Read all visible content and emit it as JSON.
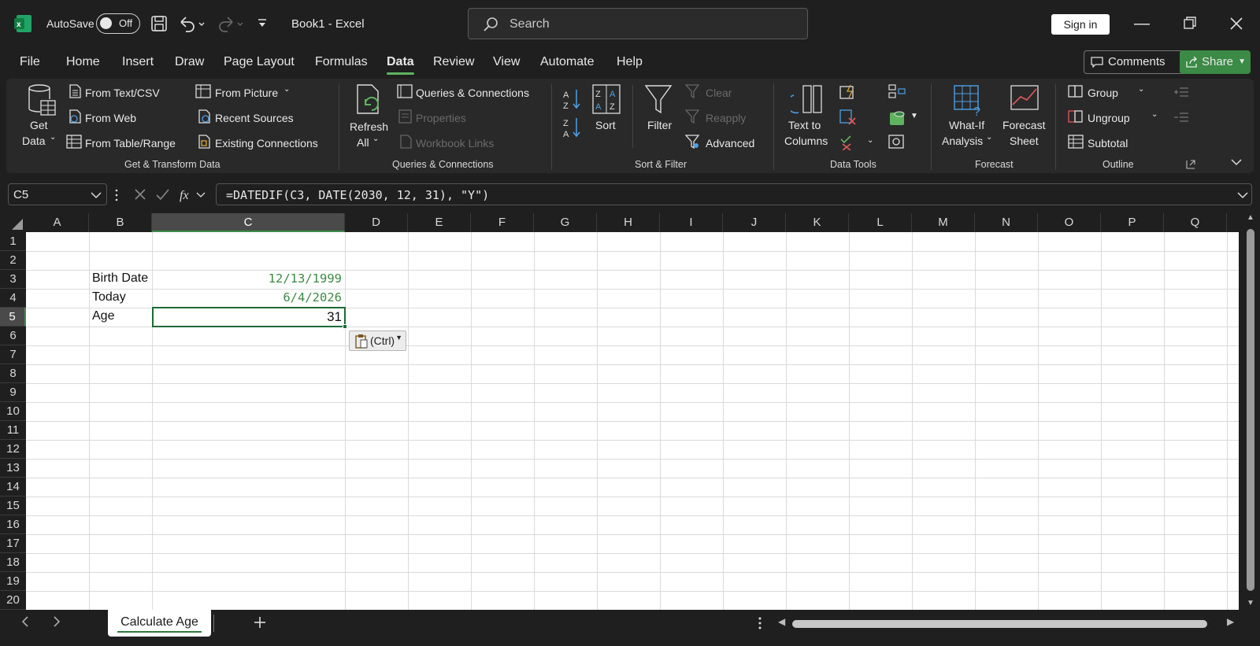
{
  "app": {
    "autosave_label": "AutoSave",
    "autosave_state": "Off",
    "title": "Book1  -  Excel",
    "search_placeholder": "Search",
    "signin_label": "Sign in"
  },
  "menu": {
    "tabs": [
      "File",
      "Home",
      "Insert",
      "Draw",
      "Page Layout",
      "Formulas",
      "Data",
      "Review",
      "View",
      "Automate",
      "Help"
    ],
    "active_tab": "Data",
    "comments_label": "Comments",
    "share_label": "Share"
  },
  "ribbon": {
    "get_data": [
      "Get",
      "Data"
    ],
    "from_text_csv": "From Text/CSV",
    "from_web": "From Web",
    "from_table_range": "From Table/Range",
    "from_picture": "From Picture",
    "recent_sources": "Recent Sources",
    "existing_connections": "Existing Connections",
    "group_get_transform": "Get & Transform Data",
    "refresh_all": [
      "Refresh",
      "All"
    ],
    "queries_connections": "Queries & Connections",
    "properties": "Properties",
    "workbook_links": "Workbook Links",
    "group_queries": "Queries & Connections",
    "sort": "Sort",
    "filter": "Filter",
    "clear": "Clear",
    "reapply": "Reapply",
    "advanced": "Advanced",
    "group_sort_filter": "Sort & Filter",
    "text_to_columns": [
      "Text to",
      "Columns"
    ],
    "group_data_tools": "Data Tools",
    "what_if": [
      "What-If",
      "Analysis"
    ],
    "forecast_sheet": [
      "Forecast",
      "Sheet"
    ],
    "group_forecast": "Forecast",
    "group": "Group",
    "ungroup": "Ungroup",
    "subtotal": "Subtotal",
    "group_outline": "Outline"
  },
  "formula_bar": {
    "name_box": "C5",
    "formula": "=DATEDIF(C3, DATE(2030, 12, 31), \"Y\")"
  },
  "grid": {
    "columns": [
      "A",
      "B",
      "C",
      "D",
      "E",
      "F",
      "G",
      "H",
      "I",
      "J",
      "K",
      "L",
      "M",
      "N",
      "O",
      "P",
      "Q"
    ],
    "rows": [
      "1",
      "2",
      "3",
      "4",
      "5",
      "6",
      "7",
      "8",
      "9",
      "10",
      "11",
      "12",
      "13",
      "14",
      "15",
      "16",
      "17",
      "18",
      "19",
      "20"
    ],
    "selected_column": "C",
    "selected_row": "5",
    "cells": {
      "B3": "Birth Date",
      "C3": "12/13/1999",
      "B4": "Today",
      "C4": "6/4/2026",
      "B5": "Age",
      "C5": "31"
    },
    "paste_options_label": "(Ctrl)"
  },
  "sheets": {
    "tabs": [
      "Calculate Age"
    ]
  },
  "colors": {
    "accent_green": "#3c8c47",
    "date_text": "#3d8a45"
  }
}
